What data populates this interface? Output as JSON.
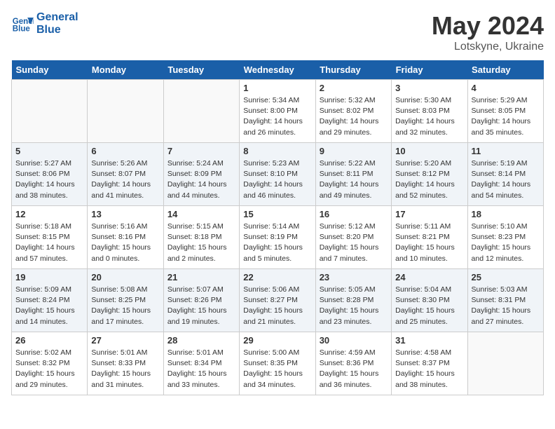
{
  "header": {
    "logo_line1": "General",
    "logo_line2": "Blue",
    "month": "May 2024",
    "location": "Lotskyne, Ukraine"
  },
  "days_of_week": [
    "Sunday",
    "Monday",
    "Tuesday",
    "Wednesday",
    "Thursday",
    "Friday",
    "Saturday"
  ],
  "weeks": [
    [
      {
        "num": "",
        "info": ""
      },
      {
        "num": "",
        "info": ""
      },
      {
        "num": "",
        "info": ""
      },
      {
        "num": "1",
        "info": "Sunrise: 5:34 AM\nSunset: 8:00 PM\nDaylight: 14 hours and 26 minutes."
      },
      {
        "num": "2",
        "info": "Sunrise: 5:32 AM\nSunset: 8:02 PM\nDaylight: 14 hours and 29 minutes."
      },
      {
        "num": "3",
        "info": "Sunrise: 5:30 AM\nSunset: 8:03 PM\nDaylight: 14 hours and 32 minutes."
      },
      {
        "num": "4",
        "info": "Sunrise: 5:29 AM\nSunset: 8:05 PM\nDaylight: 14 hours and 35 minutes."
      }
    ],
    [
      {
        "num": "5",
        "info": "Sunrise: 5:27 AM\nSunset: 8:06 PM\nDaylight: 14 hours and 38 minutes."
      },
      {
        "num": "6",
        "info": "Sunrise: 5:26 AM\nSunset: 8:07 PM\nDaylight: 14 hours and 41 minutes."
      },
      {
        "num": "7",
        "info": "Sunrise: 5:24 AM\nSunset: 8:09 PM\nDaylight: 14 hours and 44 minutes."
      },
      {
        "num": "8",
        "info": "Sunrise: 5:23 AM\nSunset: 8:10 PM\nDaylight: 14 hours and 46 minutes."
      },
      {
        "num": "9",
        "info": "Sunrise: 5:22 AM\nSunset: 8:11 PM\nDaylight: 14 hours and 49 minutes."
      },
      {
        "num": "10",
        "info": "Sunrise: 5:20 AM\nSunset: 8:12 PM\nDaylight: 14 hours and 52 minutes."
      },
      {
        "num": "11",
        "info": "Sunrise: 5:19 AM\nSunset: 8:14 PM\nDaylight: 14 hours and 54 minutes."
      }
    ],
    [
      {
        "num": "12",
        "info": "Sunrise: 5:18 AM\nSunset: 8:15 PM\nDaylight: 14 hours and 57 minutes."
      },
      {
        "num": "13",
        "info": "Sunrise: 5:16 AM\nSunset: 8:16 PM\nDaylight: 15 hours and 0 minutes."
      },
      {
        "num": "14",
        "info": "Sunrise: 5:15 AM\nSunset: 8:18 PM\nDaylight: 15 hours and 2 minutes."
      },
      {
        "num": "15",
        "info": "Sunrise: 5:14 AM\nSunset: 8:19 PM\nDaylight: 15 hours and 5 minutes."
      },
      {
        "num": "16",
        "info": "Sunrise: 5:12 AM\nSunset: 8:20 PM\nDaylight: 15 hours and 7 minutes."
      },
      {
        "num": "17",
        "info": "Sunrise: 5:11 AM\nSunset: 8:21 PM\nDaylight: 15 hours and 10 minutes."
      },
      {
        "num": "18",
        "info": "Sunrise: 5:10 AM\nSunset: 8:23 PM\nDaylight: 15 hours and 12 minutes."
      }
    ],
    [
      {
        "num": "19",
        "info": "Sunrise: 5:09 AM\nSunset: 8:24 PM\nDaylight: 15 hours and 14 minutes."
      },
      {
        "num": "20",
        "info": "Sunrise: 5:08 AM\nSunset: 8:25 PM\nDaylight: 15 hours and 17 minutes."
      },
      {
        "num": "21",
        "info": "Sunrise: 5:07 AM\nSunset: 8:26 PM\nDaylight: 15 hours and 19 minutes."
      },
      {
        "num": "22",
        "info": "Sunrise: 5:06 AM\nSunset: 8:27 PM\nDaylight: 15 hours and 21 minutes."
      },
      {
        "num": "23",
        "info": "Sunrise: 5:05 AM\nSunset: 8:28 PM\nDaylight: 15 hours and 23 minutes."
      },
      {
        "num": "24",
        "info": "Sunrise: 5:04 AM\nSunset: 8:30 PM\nDaylight: 15 hours and 25 minutes."
      },
      {
        "num": "25",
        "info": "Sunrise: 5:03 AM\nSunset: 8:31 PM\nDaylight: 15 hours and 27 minutes."
      }
    ],
    [
      {
        "num": "26",
        "info": "Sunrise: 5:02 AM\nSunset: 8:32 PM\nDaylight: 15 hours and 29 minutes."
      },
      {
        "num": "27",
        "info": "Sunrise: 5:01 AM\nSunset: 8:33 PM\nDaylight: 15 hours and 31 minutes."
      },
      {
        "num": "28",
        "info": "Sunrise: 5:01 AM\nSunset: 8:34 PM\nDaylight: 15 hours and 33 minutes."
      },
      {
        "num": "29",
        "info": "Sunrise: 5:00 AM\nSunset: 8:35 PM\nDaylight: 15 hours and 34 minutes."
      },
      {
        "num": "30",
        "info": "Sunrise: 4:59 AM\nSunset: 8:36 PM\nDaylight: 15 hours and 36 minutes."
      },
      {
        "num": "31",
        "info": "Sunrise: 4:58 AM\nSunset: 8:37 PM\nDaylight: 15 hours and 38 minutes."
      },
      {
        "num": "",
        "info": ""
      }
    ]
  ]
}
